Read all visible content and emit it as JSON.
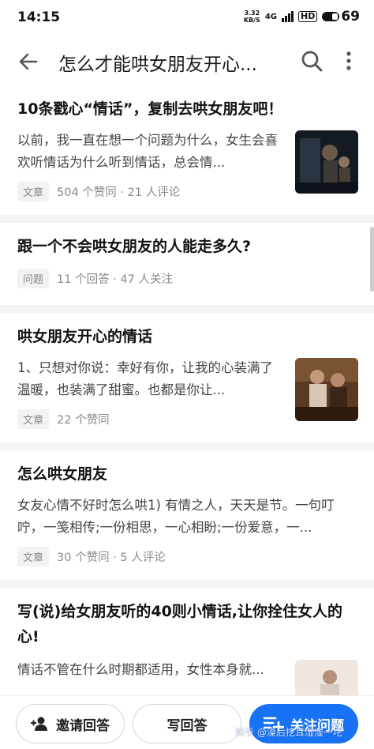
{
  "status_bar": {
    "time": "14:15",
    "net_speed_value": "3.32",
    "net_speed_unit": "KB/S",
    "signal_label": "4G",
    "hd_label": "HD",
    "battery": "69"
  },
  "header": {
    "title": "怎么才能哄女朋友开心..."
  },
  "feed": {
    "items": [
      {
        "title": "10条戳心“情话”，复制去哄女朋友吧！",
        "excerpt": "以前，我一直在想一个问题为什么，女生会喜欢听情话为什么听到情话，总会情...",
        "tag": "文章",
        "meta": "504 个赞同 · 21 人评论"
      },
      {
        "title": "跟一个不会哄女朋友的人能走多久?",
        "tag": "问题",
        "meta": "11 个回答 · 47 人关注"
      },
      {
        "title": "哄女朋友开心的情话",
        "excerpt": "1、只想对你说：幸好有你，让我的心装满了温暖，也装满了甜蜜。也都是你让...",
        "tag": "文章",
        "meta": "22 个赞同"
      },
      {
        "title": "怎么哄女朋友",
        "excerpt": "女友心情不好时怎么哄1) 有情之人，天天是节。一句叮咛，一笺相传;一份相思，一心相盼;一份爱意，一...",
        "tag": "文章",
        "meta": "30 个赞同 · 5 人评论"
      },
      {
        "title": "写(说)给女朋友听的40则小情话,让你拴住女人的心!",
        "excerpt": "情话不管在什么时期都适用，女性本身就..."
      }
    ]
  },
  "bottom_bar": {
    "invite_label": "邀请回答",
    "write_label": "写回答",
    "follow_label": "关注问题",
    "watermark": "知乎 @澡后挖耳湿湿一坨"
  },
  "colors": {
    "accent": "#1772f6",
    "background": "#f4f4f4"
  },
  "icons": [
    "back-arrow-icon",
    "search-icon",
    "more-vertical-icon",
    "invite-user-icon",
    "follow-plus-icon"
  ]
}
